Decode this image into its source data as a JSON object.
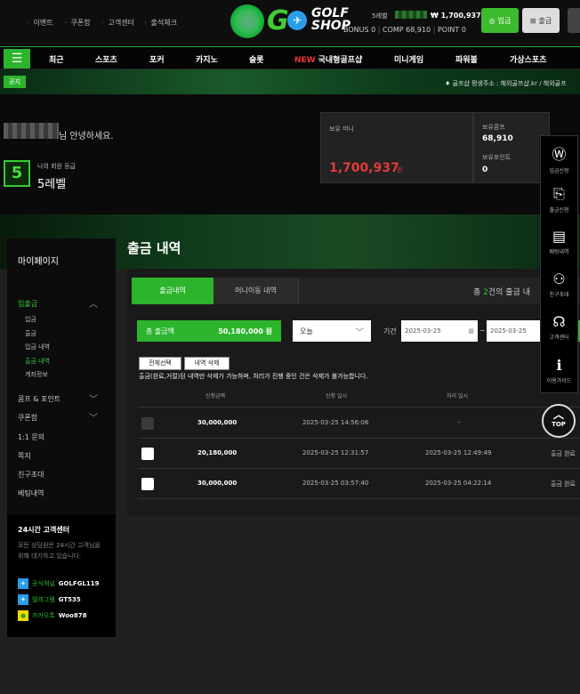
{
  "top_links": [
    "이벤트",
    "쿠폰함",
    "고객센터",
    "출석체크"
  ],
  "logo": {
    "g": "G",
    "text_line1": "GOLF",
    "text_line2": "SHOP"
  },
  "user": {
    "level_label": "5레벨",
    "balance": "₩ 1,700,937",
    "bonus_label": "BONUS",
    "bonus_value": "0",
    "comp_label": "COMP",
    "comp_value": "68,910",
    "point_label": "POINT",
    "point_value": "0"
  },
  "header_buttons": {
    "deposit": "입금",
    "withdraw": "출금"
  },
  "nav": {
    "items": [
      "최근",
      "스포츠",
      "포커",
      "카지노",
      "슬롯",
      "국내형골프샵",
      "미니게임",
      "파워볼",
      "가상스포츠"
    ],
    "new_badge": "NEW"
  },
  "notice": {
    "badge": "공지",
    "text": "골프샵 평생주소 : 해외골프샵.kr / 해외골프"
  },
  "greeting": "님 안녕하세요.",
  "level": {
    "icon": "5",
    "caption": "나의 회원 등급",
    "value": "5레벨"
  },
  "money": {
    "label": "보유 머니",
    "value": "1,700,937",
    "unit": "원"
  },
  "points": {
    "comp_label": "보유콤프",
    "comp_value": "68,910",
    "point_label": "보유포인트",
    "point_value": "0"
  },
  "page_title": "출금 내역",
  "sidebar": {
    "title": "마이페이지",
    "group1": "입출금",
    "sub_items": [
      "입금",
      "출금",
      "입금 내역",
      "출금 내역",
      "계좌정보"
    ],
    "items": [
      "콤프 & 포인트",
      "쿠폰함",
      "1:1 문의",
      "쪽지",
      "친구초대",
      "베팅내역"
    ]
  },
  "customer_service": {
    "title": "24시간 고객센터",
    "desc": "모든 상담원은 24시간 고객님을 위해 대기하고 있습니다.",
    "contacts": [
      {
        "label": "공식채널",
        "value": "GOLFGL119"
      },
      {
        "label": "텔레그램",
        "value": "GT535"
      },
      {
        "label": "카카오톡",
        "value": "Woo878"
      }
    ]
  },
  "tabs": {
    "active": "출금내역",
    "second": "머니이동 내역"
  },
  "total": {
    "prefix": "총",
    "count": "2",
    "suffix": "건의 출금 내"
  },
  "filter": {
    "sum_label": "총 출금액",
    "sum_value": "50,180,000 원",
    "period_option": "오늘",
    "period_label": "기간",
    "date_from": "2025-03-25",
    "date_to": "2025-03-25",
    "tilde": "~"
  },
  "actions": {
    "select_all": "전체선택",
    "delete": "내역 삭제"
  },
  "delete_notice": "출금(완료,거절)된 내역만 삭제가 가능하며, 처리가 진행 중인 건은 삭제가 불가능합니다.",
  "table": {
    "headers": [
      "신청금액",
      "신청 일시",
      "처리 일시"
    ],
    "rows": [
      {
        "amount": "30,000,000",
        "requested": "2025-03-25 14:56:06",
        "processed": "-",
        "status": ""
      },
      {
        "amount": "20,180,000",
        "requested": "2025-03-25 12:31:57",
        "processed": "2025-03-25 12:49:49",
        "status": "출금 완료"
      },
      {
        "amount": "30,000,000",
        "requested": "2025-03-25 03:57:40",
        "processed": "2025-03-25 04:22:14",
        "status": "출금 완료"
      }
    ]
  },
  "float_menu": [
    "입금신청",
    "출금신청",
    "배팅내역",
    "친구초대",
    "고객센터",
    "이용가이드"
  ],
  "top_button": "TOP",
  "colors": {
    "accent": "#2cb52c",
    "money_red": "#e23b3b"
  }
}
